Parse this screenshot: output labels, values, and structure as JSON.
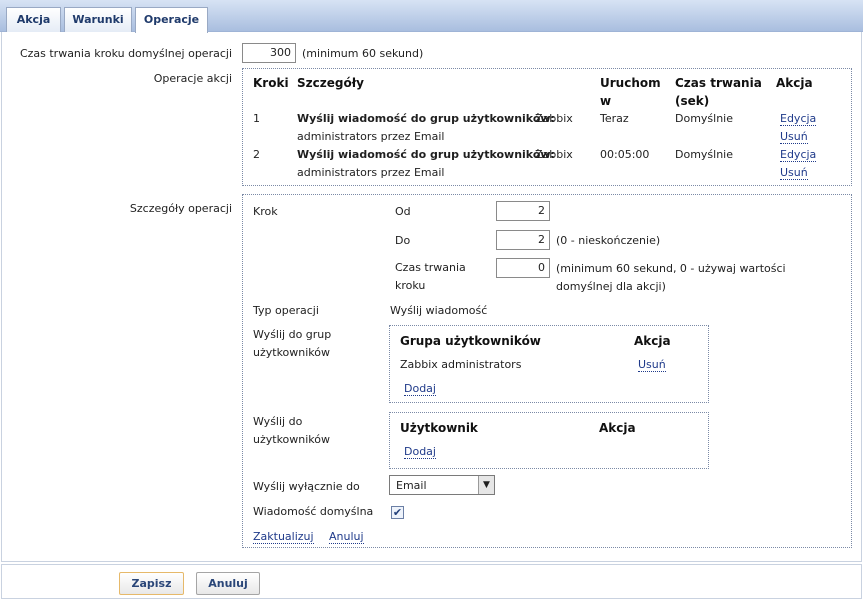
{
  "tabs": [
    {
      "label": "Akcja"
    },
    {
      "label": "Warunki"
    },
    {
      "label": "Operacje"
    }
  ],
  "step_duration": {
    "label": "Czas trwania kroku domyślnej operacji",
    "value": "300",
    "hint": "(minimum 60 sekund)"
  },
  "operations": {
    "label": "Operacje akcji",
    "headers": {
      "steps": "Kroki",
      "details": "Szczegóły",
      "start_1": "Uruchom",
      "start_2": "w",
      "duration_1": "Czas trwania",
      "duration_2": "(sek)",
      "action": "Akcja"
    },
    "rows": [
      {
        "step": "1",
        "details_bold": "Wyślij wiadomość do grup użytkowników:",
        "details_rest1": "Zabbix",
        "details_rest2": "administrators przez Email",
        "start": "Teraz",
        "duration": "Domyślnie",
        "edit": "Edycja",
        "remove": "Usuń"
      },
      {
        "step": "2",
        "details_bold": "Wyślij wiadomość do grup użytkowników:",
        "details_rest1": "Zabbix",
        "details_rest2": "administrators przez Email",
        "start": "00:05:00",
        "duration": "Domyślnie",
        "edit": "Edycja",
        "remove": "Usuń"
      }
    ]
  },
  "op_details": {
    "label": "Szczegóły operacji",
    "step_label": "Krok",
    "from_label": "Od",
    "from_value": "2",
    "to_label": "Do",
    "to_value": "2",
    "to_hint": "(0 - nieskończenie)",
    "dur_label_1": "Czas trwania",
    "dur_label_2": "kroku",
    "dur_value": "0",
    "dur_hint_1": "(minimum 60 sekund, 0 - używaj wartości",
    "dur_hint_2": "domyślnej dla akcji)",
    "op_type_label": "Typ operacji",
    "op_type_value": "Wyślij wiadomość",
    "send_groups_label_1": "Wyślij do grup",
    "send_groups_label_2": "użytkowników",
    "groups_header": "Grupa użytkowników",
    "groups_action_header": "Akcja",
    "group_name": "Zabbix administrators",
    "group_remove": "Usuń",
    "groups_add": "Dodaj",
    "send_users_label_1": "Wyślij do",
    "send_users_label_2": "użytkowników",
    "users_header": "Użytkownik",
    "users_action_header": "Akcja",
    "users_add": "Dodaj",
    "send_only_label": "Wyślij wyłącznie do",
    "send_only_value": "Email",
    "default_msg_label": "Wiadomość domyślna",
    "default_msg_check": "✔",
    "update_link": "Zaktualizuj",
    "cancel_link": "Anuluj"
  },
  "footer": {
    "save": "Zapisz",
    "cancel": "Anuluj"
  }
}
